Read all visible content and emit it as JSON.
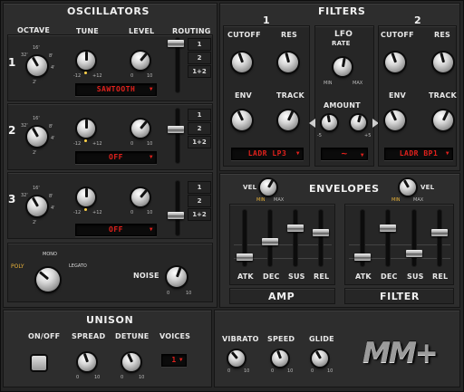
{
  "oscillators": {
    "title": "OSCILLATORS",
    "col_octave": "OCTAVE",
    "col_tune": "TUNE",
    "col_level": "LEVEL",
    "col_routing": "ROUTING",
    "rows": [
      {
        "number": "1",
        "waveform": "SAWTOOTH",
        "routing": [
          "1",
          "2",
          "1+2"
        ]
      },
      {
        "number": "2",
        "waveform": "OFF",
        "routing": [
          "1",
          "2",
          "1+2"
        ]
      },
      {
        "number": "3",
        "waveform": "OFF",
        "routing": [
          "1",
          "2",
          "1+2"
        ]
      }
    ],
    "octave_ticks": [
      "16'",
      "8'",
      "4'",
      "2'",
      "32'"
    ],
    "tune_min": "-12",
    "tune_max": "+12",
    "level_min": "0",
    "level_max": "10"
  },
  "poly": {
    "poly_label": "POLY",
    "mono_label": "MONO",
    "legato_label": "LEGATO",
    "noise_label": "NOISE",
    "noise_min": "0",
    "noise_max": "10"
  },
  "filters": {
    "title": "FILTERS",
    "filter1_num": "1",
    "filter2_num": "2",
    "cutoff": "CUTOFF",
    "res": "RES",
    "env": "ENV",
    "track": "TRACK",
    "lfo_title": "LFO",
    "lfo_rate": "RATE",
    "lfo_min": "MIN",
    "lfo_max": "MAX",
    "amount": "AMOUNT",
    "filter1_type": "LADR LP3",
    "filter2_type": "LADR BP1",
    "lfo_wave": "~",
    "amount_left": "-5",
    "amount_right": "+5"
  },
  "envelopes": {
    "title": "ENVELOPES",
    "vel_left": "VEL",
    "vel_left_min": "MIN",
    "vel_left_max": "MAX",
    "vel_right": "VEL",
    "vel_right_min": "MIN",
    "vel_right_max": "MAX",
    "amp_title": "AMP",
    "filter_title": "FILTER",
    "amp_labels": [
      "ATK",
      "DEC",
      "SUS",
      "REL"
    ],
    "filter_labels": [
      "ATK",
      "DEC",
      "SUS",
      "REL"
    ],
    "amp_levels": [
      0.15,
      0.45,
      0.72,
      0.62
    ],
    "filter_levels": [
      0.15,
      0.72,
      0.22,
      0.62
    ]
  },
  "unison": {
    "title": "UNISON",
    "onoff": "ON/OFF",
    "spread": "SPREAD",
    "detune": "DETUNE",
    "voices": "VOICES",
    "voices_value": "1",
    "spread_min": "0",
    "spread_max": "10",
    "detune_min": "0",
    "detune_max": "10"
  },
  "mod": {
    "vibrato": "VIBRATO",
    "speed": "SPEED",
    "glide": "GLIDE",
    "min": "0",
    "max": "10"
  },
  "logo": {
    "text": "MM+"
  },
  "colors": {
    "lcd_text": "#e2211c",
    "knob_dot": "#ffd24a",
    "panel": "#2d2d2d"
  }
}
